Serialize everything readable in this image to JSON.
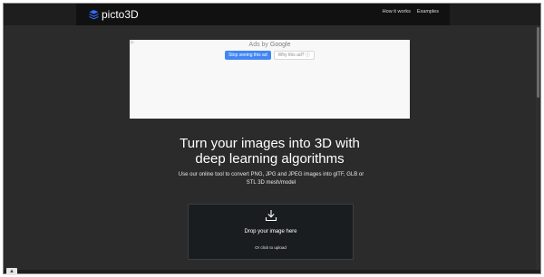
{
  "brand": {
    "name": "picto3D",
    "icon": "layered-cube-icon",
    "color": "#2f6df6"
  },
  "nav": {
    "links": [
      "How it works",
      "Examples"
    ]
  },
  "ad": {
    "flag": "▷",
    "ads_by_prefix": "Ads by",
    "ads_by_brand": "Google",
    "stop_button": "Stop seeing this ad",
    "why_button": "Why this ad? ⓘ"
  },
  "hero": {
    "headline_line1": "Turn your images into 3D with",
    "headline_line2": "deep learning algorithms",
    "subtext_line1": "Use our online tool to convert PNG, JPG and JPEG images into glTF, GLB or",
    "subtext_line2": "STL 3D mesh/model"
  },
  "upload": {
    "icon": "download-icon",
    "title": "Drop your image here",
    "subtitle": "Or click to upload"
  },
  "scroll_top": {
    "label": "▲",
    "icon": "chevron-up-icon"
  }
}
